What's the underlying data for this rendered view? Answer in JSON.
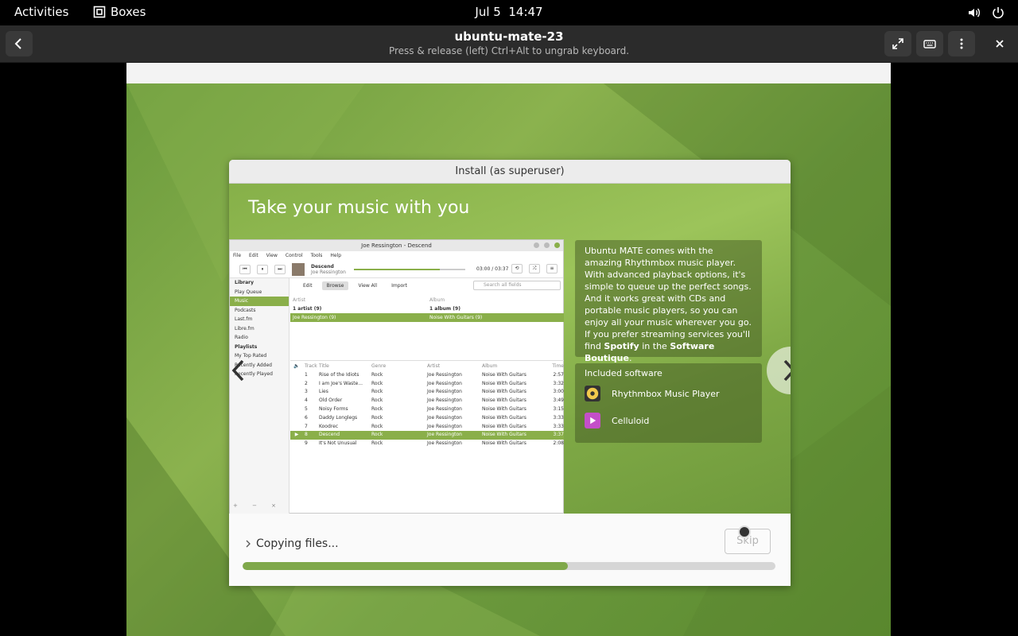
{
  "topbar": {
    "activities": "Activities",
    "app_name": "Boxes",
    "date": "Jul 5",
    "time": "14:47"
  },
  "header": {
    "title": "ubuntu-mate-23",
    "subtitle": "Press & release (left) Ctrl+Alt to ungrab keyboard."
  },
  "installer": {
    "window_title": "Install (as superuser)",
    "slide_heading": "Take your music with you",
    "info_segments": [
      {
        "text": "Ubuntu MATE comes with the amazing Rhythmbox music player. With advanced playback options, it's simple to queue up the perfect songs. And it works great with CDs and portable music players, so you can enjoy all your music wherever you go. If you prefer streaming services you'll find ",
        "bold": false
      },
      {
        "text": "Spotify",
        "bold": true
      },
      {
        "text": " in the ",
        "bold": false
      },
      {
        "text": "Software Boutique",
        "bold": true
      },
      {
        "text": ".",
        "bold": false
      }
    ],
    "included_title": "Included software",
    "software": [
      {
        "name": "Rhythmbox Music Player",
        "icon": "rhythmbox-icon",
        "color": "#f2c94c"
      },
      {
        "name": "Celluloid",
        "icon": "celluloid-icon",
        "color": "#c44fc9"
      }
    ],
    "status_text": "Copying files...",
    "skip_label": "Skip",
    "progress": 0.61
  },
  "rhythmbox": {
    "title": "Joe Ressington - Descend",
    "menu": [
      "File",
      "Edit",
      "View",
      "Control",
      "Tools",
      "Help"
    ],
    "now_playing_title": "Descend",
    "now_playing_artist": "Joe Ressington",
    "time": "03:00 / 03:37",
    "library_label": "Library",
    "library": [
      "Play Queue",
      "Music",
      "Podcasts",
      "Last.fm",
      "Libre.fm",
      "Radio"
    ],
    "playlists_label": "Playlists",
    "playlists": [
      "My Top Rated",
      "Recently Added",
      "Recently Played"
    ],
    "tabs": [
      "Edit",
      "Browse",
      "View All",
      "Import"
    ],
    "search_placeholder": "Search all fields",
    "artist_header": "Artist",
    "album_header": "Album",
    "artist_all": "1 artist (9)",
    "album_all": "1 album (9)",
    "artist_sel": "Joe Ressington (9)",
    "album_sel": "Noise With Guitars (9)",
    "columns": [
      "Track",
      "Title",
      "Genre",
      "Artist",
      "Album",
      "Time"
    ],
    "tracks": [
      {
        "n": "1",
        "title": "Rise of the Idiots",
        "genre": "Rock",
        "artist": "Joe Ressington",
        "album": "Noise With Guitars",
        "time": "2:57"
      },
      {
        "n": "2",
        "title": "I am Joe's Waste...",
        "genre": "Rock",
        "artist": "Joe Ressington",
        "album": "Noise With Guitars",
        "time": "3:32"
      },
      {
        "n": "3",
        "title": "Lies",
        "genre": "Rock",
        "artist": "Joe Ressington",
        "album": "Noise With Guitars",
        "time": "3:00"
      },
      {
        "n": "4",
        "title": "Old Order",
        "genre": "Rock",
        "artist": "Joe Ressington",
        "album": "Noise With Guitars",
        "time": "3:49"
      },
      {
        "n": "5",
        "title": "Noisy Forms",
        "genre": "Rock",
        "artist": "Joe Ressington",
        "album": "Noise With Guitars",
        "time": "3:15"
      },
      {
        "n": "6",
        "title": "Daddy Longlegs",
        "genre": "Rock",
        "artist": "Joe Ressington",
        "album": "Noise With Guitars",
        "time": "3:33"
      },
      {
        "n": "7",
        "title": "Koodrec",
        "genre": "Rock",
        "artist": "Joe Ressington",
        "album": "Noise With Guitars",
        "time": "3:33"
      },
      {
        "n": "8",
        "title": "Descend",
        "genre": "Rock",
        "artist": "Joe Ressington",
        "album": "Noise With Guitars",
        "time": "3:37"
      },
      {
        "n": "9",
        "title": "It's Not Unusual",
        "genre": "Rock",
        "artist": "Joe Ressington",
        "album": "Noise With Guitars",
        "time": "2:08"
      }
    ],
    "playing_index": 7
  },
  "colors": {
    "accent": "#8aaf4a",
    "progress": "#7fa84a"
  }
}
